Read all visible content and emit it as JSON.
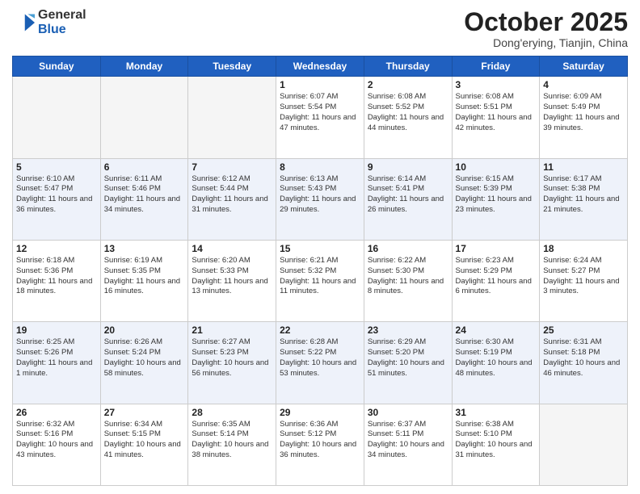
{
  "header": {
    "logo_line1": "General",
    "logo_line2": "Blue",
    "month": "October 2025",
    "location": "Dong'erying, Tianjin, China"
  },
  "days_of_week": [
    "Sunday",
    "Monday",
    "Tuesday",
    "Wednesday",
    "Thursday",
    "Friday",
    "Saturday"
  ],
  "weeks": [
    [
      {
        "day": "",
        "info": ""
      },
      {
        "day": "",
        "info": ""
      },
      {
        "day": "",
        "info": ""
      },
      {
        "day": "1",
        "info": "Sunrise: 6:07 AM\nSunset: 5:54 PM\nDaylight: 11 hours and 47 minutes."
      },
      {
        "day": "2",
        "info": "Sunrise: 6:08 AM\nSunset: 5:52 PM\nDaylight: 11 hours and 44 minutes."
      },
      {
        "day": "3",
        "info": "Sunrise: 6:08 AM\nSunset: 5:51 PM\nDaylight: 11 hours and 42 minutes."
      },
      {
        "day": "4",
        "info": "Sunrise: 6:09 AM\nSunset: 5:49 PM\nDaylight: 11 hours and 39 minutes."
      }
    ],
    [
      {
        "day": "5",
        "info": "Sunrise: 6:10 AM\nSunset: 5:47 PM\nDaylight: 11 hours and 36 minutes."
      },
      {
        "day": "6",
        "info": "Sunrise: 6:11 AM\nSunset: 5:46 PM\nDaylight: 11 hours and 34 minutes."
      },
      {
        "day": "7",
        "info": "Sunrise: 6:12 AM\nSunset: 5:44 PM\nDaylight: 11 hours and 31 minutes."
      },
      {
        "day": "8",
        "info": "Sunrise: 6:13 AM\nSunset: 5:43 PM\nDaylight: 11 hours and 29 minutes."
      },
      {
        "day": "9",
        "info": "Sunrise: 6:14 AM\nSunset: 5:41 PM\nDaylight: 11 hours and 26 minutes."
      },
      {
        "day": "10",
        "info": "Sunrise: 6:15 AM\nSunset: 5:39 PM\nDaylight: 11 hours and 23 minutes."
      },
      {
        "day": "11",
        "info": "Sunrise: 6:17 AM\nSunset: 5:38 PM\nDaylight: 11 hours and 21 minutes."
      }
    ],
    [
      {
        "day": "12",
        "info": "Sunrise: 6:18 AM\nSunset: 5:36 PM\nDaylight: 11 hours and 18 minutes."
      },
      {
        "day": "13",
        "info": "Sunrise: 6:19 AM\nSunset: 5:35 PM\nDaylight: 11 hours and 16 minutes."
      },
      {
        "day": "14",
        "info": "Sunrise: 6:20 AM\nSunset: 5:33 PM\nDaylight: 11 hours and 13 minutes."
      },
      {
        "day": "15",
        "info": "Sunrise: 6:21 AM\nSunset: 5:32 PM\nDaylight: 11 hours and 11 minutes."
      },
      {
        "day": "16",
        "info": "Sunrise: 6:22 AM\nSunset: 5:30 PM\nDaylight: 11 hours and 8 minutes."
      },
      {
        "day": "17",
        "info": "Sunrise: 6:23 AM\nSunset: 5:29 PM\nDaylight: 11 hours and 6 minutes."
      },
      {
        "day": "18",
        "info": "Sunrise: 6:24 AM\nSunset: 5:27 PM\nDaylight: 11 hours and 3 minutes."
      }
    ],
    [
      {
        "day": "19",
        "info": "Sunrise: 6:25 AM\nSunset: 5:26 PM\nDaylight: 11 hours and 1 minute."
      },
      {
        "day": "20",
        "info": "Sunrise: 6:26 AM\nSunset: 5:24 PM\nDaylight: 10 hours and 58 minutes."
      },
      {
        "day": "21",
        "info": "Sunrise: 6:27 AM\nSunset: 5:23 PM\nDaylight: 10 hours and 56 minutes."
      },
      {
        "day": "22",
        "info": "Sunrise: 6:28 AM\nSunset: 5:22 PM\nDaylight: 10 hours and 53 minutes."
      },
      {
        "day": "23",
        "info": "Sunrise: 6:29 AM\nSunset: 5:20 PM\nDaylight: 10 hours and 51 minutes."
      },
      {
        "day": "24",
        "info": "Sunrise: 6:30 AM\nSunset: 5:19 PM\nDaylight: 10 hours and 48 minutes."
      },
      {
        "day": "25",
        "info": "Sunrise: 6:31 AM\nSunset: 5:18 PM\nDaylight: 10 hours and 46 minutes."
      }
    ],
    [
      {
        "day": "26",
        "info": "Sunrise: 6:32 AM\nSunset: 5:16 PM\nDaylight: 10 hours and 43 minutes."
      },
      {
        "day": "27",
        "info": "Sunrise: 6:34 AM\nSunset: 5:15 PM\nDaylight: 10 hours and 41 minutes."
      },
      {
        "day": "28",
        "info": "Sunrise: 6:35 AM\nSunset: 5:14 PM\nDaylight: 10 hours and 38 minutes."
      },
      {
        "day": "29",
        "info": "Sunrise: 6:36 AM\nSunset: 5:12 PM\nDaylight: 10 hours and 36 minutes."
      },
      {
        "day": "30",
        "info": "Sunrise: 6:37 AM\nSunset: 5:11 PM\nDaylight: 10 hours and 34 minutes."
      },
      {
        "day": "31",
        "info": "Sunrise: 6:38 AM\nSunset: 5:10 PM\nDaylight: 10 hours and 31 minutes."
      },
      {
        "day": "",
        "info": ""
      }
    ]
  ]
}
